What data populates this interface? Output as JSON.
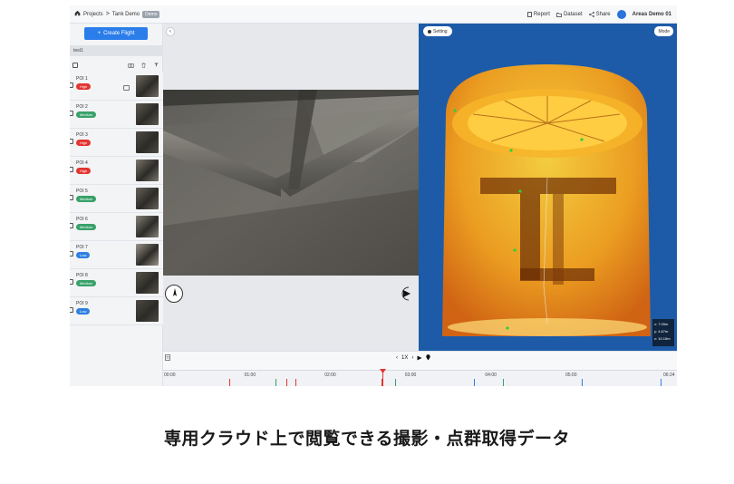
{
  "topbar": {
    "breadcrumb": {
      "projects": "Projects",
      "sep": ">",
      "project": "Tank Demo",
      "tag": "Demo"
    },
    "actions": {
      "report": "Report",
      "dataset": "Dataset",
      "share": "Share"
    },
    "user": "Areas Demo 01"
  },
  "sidebar": {
    "create_button": "Create Flight",
    "flight_name": "test1",
    "pois": [
      {
        "name": "POI 1",
        "priority": "High"
      },
      {
        "name": "POI 2",
        "priority": "Medium"
      },
      {
        "name": "POI 3",
        "priority": "High"
      },
      {
        "name": "POI 4",
        "priority": "High"
      },
      {
        "name": "POI 5",
        "priority": "Medium"
      },
      {
        "name": "POI 6",
        "priority": "Medium"
      },
      {
        "name": "POI 7",
        "priority": "Low"
      },
      {
        "name": "POI 8",
        "priority": "Medium"
      },
      {
        "name": "POI 9",
        "priority": "Low"
      }
    ]
  },
  "priority_colors": {
    "High": "#e3342f",
    "Medium": "#38a169",
    "Low": "#2f7fe0"
  },
  "cloud": {
    "setting_label": "Setting",
    "mode_label": "Mode",
    "coords": {
      "x": "x: 7.09m",
      "y": "y: 4.67m",
      "z": "z: 10.15m"
    }
  },
  "timeline": {
    "speed": "1X",
    "ticks": [
      "00:00",
      "01:00",
      "02:00",
      "03:00",
      "04:00",
      "05:00",
      "06:24"
    ],
    "markers": [
      {
        "frac": 0.128,
        "color": "red"
      },
      {
        "frac": 0.218,
        "color": "green"
      },
      {
        "frac": 0.24,
        "color": "red"
      },
      {
        "frac": 0.258,
        "color": "red"
      },
      {
        "frac": 0.425,
        "color": "red"
      },
      {
        "frac": 0.452,
        "color": "green"
      },
      {
        "frac": 0.605,
        "color": "blue"
      },
      {
        "frac": 0.662,
        "color": "green"
      },
      {
        "frac": 0.815,
        "color": "blue"
      },
      {
        "frac": 0.968,
        "color": "blue"
      }
    ],
    "playhead_frac": 0.428
  },
  "caption": "専用クラウド上で閲覧できる撮影・点群取得データ"
}
